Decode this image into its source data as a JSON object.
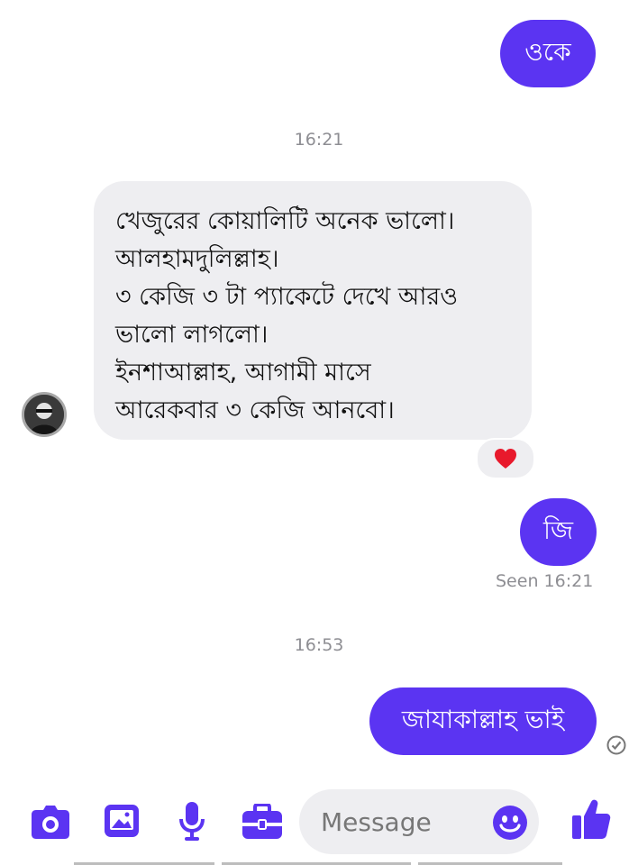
{
  "colors": {
    "accent": "#5b34f2",
    "incoming_bubble": "#eeeef1",
    "timestamp": "#8e8e93",
    "reaction_heart": "#e8192c"
  },
  "messages": {
    "top_outgoing": "ওকে",
    "timestamp_1": "16:21",
    "incoming_lines": [
      "খেজুরের কোয়ালিটি অনেক ভালো।",
      "আলহামদুলিল্লাহ।",
      "৩ কেজি ৩ টা প্যাকেটে দেখে আরও",
      "ভালো লাগলো।",
      "ইনশাআল্লাহ, আগামী মাসে",
      "আরেকবার ৩ কেজি আনবো।"
    ],
    "reaction": "heart",
    "reply_outgoing": "জি",
    "seen_status": "Seen 16:21",
    "timestamp_2": "16:53",
    "last_outgoing": "জাযাকাল্লাহ ভাই"
  },
  "composer": {
    "placeholder": "Message",
    "icons": [
      "camera-icon",
      "gallery-icon",
      "microphone-icon",
      "toolbox-icon",
      "emoji-icon",
      "like-icon"
    ]
  }
}
